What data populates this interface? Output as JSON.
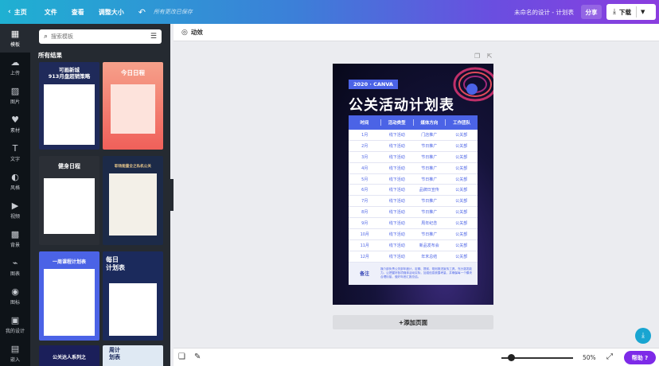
{
  "topbar": {
    "home": "主页",
    "file": "文件",
    "view": "查看",
    "resize": "调整大小",
    "saved": "所有更改已保存",
    "doc_title": "未命名的设计 - 计划表",
    "share": "分享",
    "download": "下载"
  },
  "rail": [
    {
      "icon": "▦",
      "label": "模板"
    },
    {
      "icon": "☁",
      "label": "上传"
    },
    {
      "icon": "▨",
      "label": "图片"
    },
    {
      "icon": "♥",
      "label": "素材"
    },
    {
      "icon": "T",
      "label": "文字"
    },
    {
      "icon": "◐",
      "label": "风格"
    },
    {
      "icon": "▶",
      "label": "视频"
    },
    {
      "icon": "▩",
      "label": "背景"
    },
    {
      "icon": "⌁",
      "label": "图表"
    },
    {
      "icon": "◉",
      "label": "图标"
    },
    {
      "icon": "▣",
      "label": "我的设计"
    },
    {
      "icon": "▤",
      "label": "嵌入"
    }
  ],
  "panel": {
    "search_placeholder": "搜索模板",
    "results_title": "所有结果",
    "thumbs": [
      {
        "title": "可画新城\n913月盘超销策略"
      },
      {
        "title": "今日日程"
      },
      {
        "title": "健身日程"
      },
      {
        "title": "职场能量全之私机公关"
      },
      {
        "title": "一周课程计划表"
      },
      {
        "title": "每日\n计划表"
      },
      {
        "title": "公关达人系列之"
      },
      {
        "title": "周计\n划表"
      }
    ]
  },
  "toolbar2": {
    "animate": "动效"
  },
  "poster": {
    "tag": "2020 · CANVA",
    "title": "公关活动计划表",
    "headers": [
      "时间",
      "活动类型",
      "媒体方向",
      "工作团队"
    ],
    "rows": [
      [
        "1月",
        "线下活动",
        "门店推广",
        "公关部"
      ],
      [
        "2月",
        "线下活动",
        "节日推广",
        "公关部"
      ],
      [
        "3月",
        "线下活动",
        "节日推广",
        "公关部"
      ],
      [
        "4月",
        "线下活动",
        "节日推广",
        "公关部"
      ],
      [
        "5月",
        "线下活动",
        "节日推广",
        "公关部"
      ],
      [
        "6月",
        "线下活动",
        "品牌日宣传",
        "公关部"
      ],
      [
        "7月",
        "线下活动",
        "节日推广",
        "公关部"
      ],
      [
        "8月",
        "线下活动",
        "节日推广",
        "公关部"
      ],
      [
        "9月",
        "线下活动",
        "周年纪念",
        "公关部"
      ],
      [
        "10月",
        "线下活动",
        "节日推广",
        "公关部"
      ],
      [
        "11月",
        "线下活动",
        "新品发布会",
        "公关部"
      ],
      [
        "12月",
        "线下活动",
        "年末总结",
        "公关部"
      ]
    ],
    "note_label": "备注",
    "note_text": "媒介部负责公关部年度计，定期、提前、规划推进宣传工具，充分激发能力。让把握好各项媒体活动实际，加强信息披露考量，并确保每一个模块合理衔接，做好年底汇报总结。"
  },
  "add_page": "+添加页面",
  "bottombar": {
    "zoom": "50%",
    "help": "帮助 ?"
  }
}
